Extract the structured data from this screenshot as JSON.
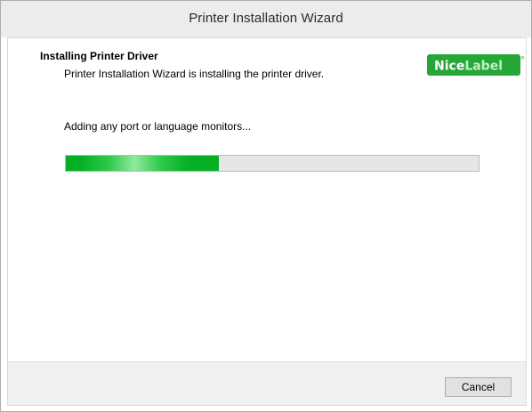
{
  "window": {
    "title": "Printer Installation Wizard"
  },
  "header": {
    "title": "Installing Printer Driver",
    "subtitle": "Printer Installation Wizard is installing the printer driver.",
    "logo": {
      "text_part1": "Nice",
      "text_part2": "Label",
      "trademark": "®",
      "bg_color": "#27a638",
      "text1_color": "#ffffff",
      "text2_color": "#bff3c3"
    }
  },
  "main": {
    "status_text": "Adding any port or language monitors...",
    "progress": {
      "percent": 37,
      "fill_color": "#06b025"
    }
  },
  "footer": {
    "cancel_label": "Cancel"
  }
}
